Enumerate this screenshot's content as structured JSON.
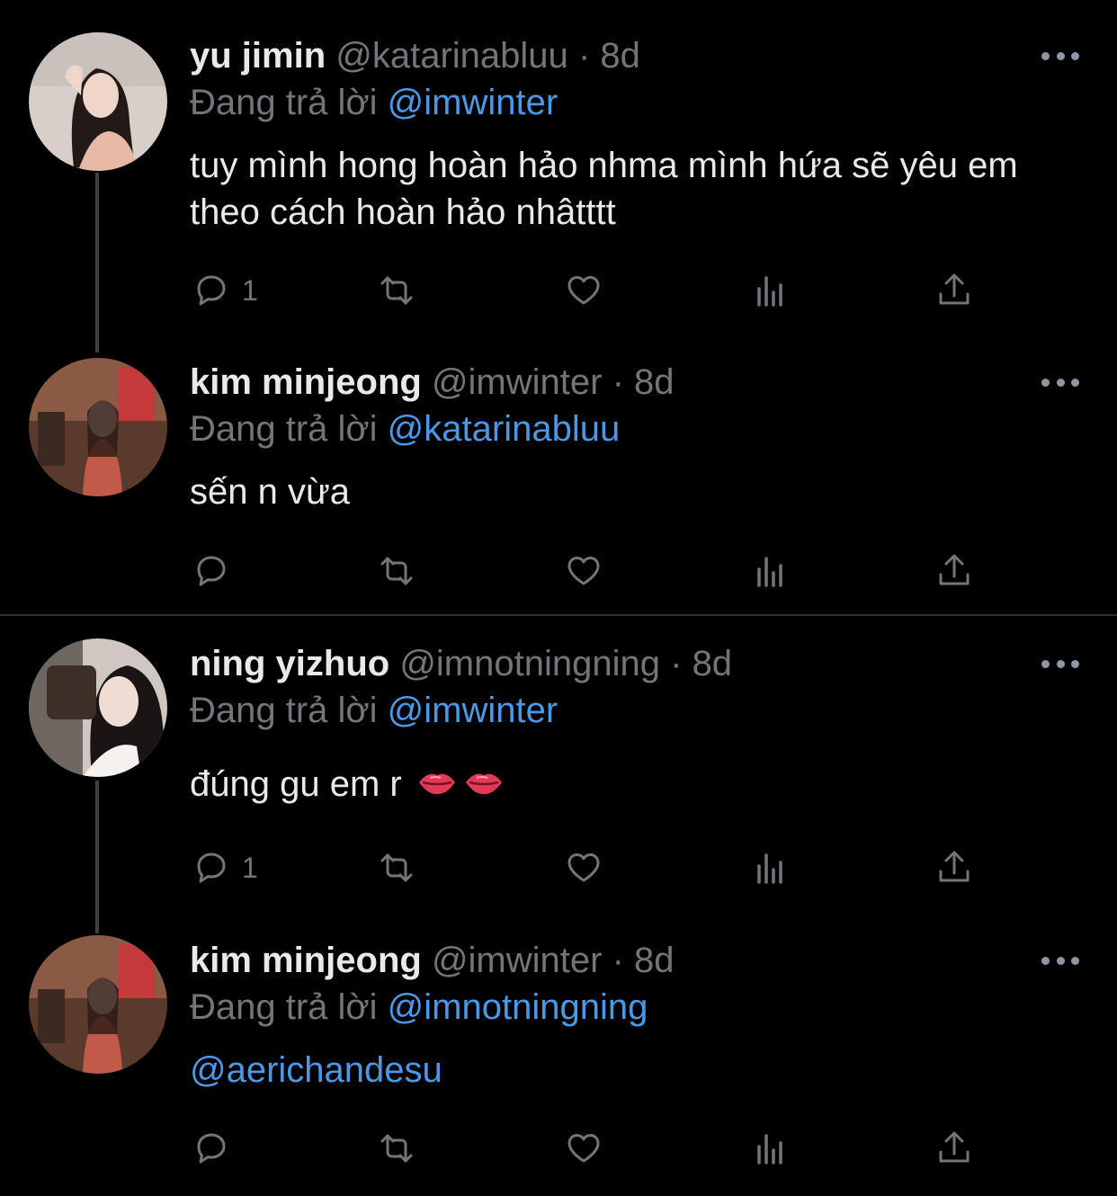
{
  "reply_prefix": "Đang trả lời",
  "tweets": [
    {
      "name": "yu jimin",
      "handle": "@katarinabluu",
      "dot": "·",
      "time": "8d",
      "reply_to": "@imwinter",
      "text": "tuy mình hong hoàn hảo nhma mình hứa sẽ yêu em theo cách hoàn hảo nhâtttt",
      "reply_count": "1"
    },
    {
      "name": "kim minjeong",
      "handle": "@imwinter",
      "dot": "·",
      "time": "8d",
      "reply_to": "@katarinabluu",
      "text": "sến n vừa",
      "reply_count": ""
    },
    {
      "name": "ning yizhuo",
      "handle": "@imnotningning",
      "dot": "·",
      "time": "8d",
      "reply_to": "@imwinter",
      "text": "đúng gu em r",
      "emoji": "lips-emoji",
      "reply_count": "1"
    },
    {
      "name": "kim minjeong",
      "handle": "@imwinter",
      "dot": "·",
      "time": "8d",
      "reply_to": "@imnotningning",
      "text": "@aerichandesu",
      "reply_count": ""
    }
  ],
  "icons": [
    "reply-icon",
    "retweet-icon",
    "like-icon",
    "views-icon",
    "share-icon",
    "more-icon"
  ],
  "colors": {
    "background": "#000000",
    "text": "#e7e9ea",
    "secondary": "#71767b",
    "link": "#4a99e9",
    "line": "#3e4144"
  }
}
